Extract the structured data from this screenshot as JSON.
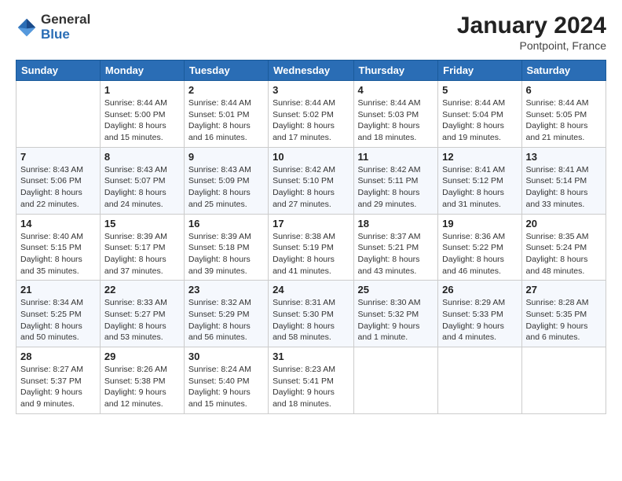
{
  "logo": {
    "general": "General",
    "blue": "Blue"
  },
  "title": "January 2024",
  "subtitle": "Pontpoint, France",
  "header_days": [
    "Sunday",
    "Monday",
    "Tuesday",
    "Wednesday",
    "Thursday",
    "Friday",
    "Saturday"
  ],
  "weeks": [
    [
      {
        "day": "",
        "info": ""
      },
      {
        "day": "1",
        "info": "Sunrise: 8:44 AM\nSunset: 5:00 PM\nDaylight: 8 hours\nand 15 minutes."
      },
      {
        "day": "2",
        "info": "Sunrise: 8:44 AM\nSunset: 5:01 PM\nDaylight: 8 hours\nand 16 minutes."
      },
      {
        "day": "3",
        "info": "Sunrise: 8:44 AM\nSunset: 5:02 PM\nDaylight: 8 hours\nand 17 minutes."
      },
      {
        "day": "4",
        "info": "Sunrise: 8:44 AM\nSunset: 5:03 PM\nDaylight: 8 hours\nand 18 minutes."
      },
      {
        "day": "5",
        "info": "Sunrise: 8:44 AM\nSunset: 5:04 PM\nDaylight: 8 hours\nand 19 minutes."
      },
      {
        "day": "6",
        "info": "Sunrise: 8:44 AM\nSunset: 5:05 PM\nDaylight: 8 hours\nand 21 minutes."
      }
    ],
    [
      {
        "day": "7",
        "info": "Sunrise: 8:43 AM\nSunset: 5:06 PM\nDaylight: 8 hours\nand 22 minutes."
      },
      {
        "day": "8",
        "info": "Sunrise: 8:43 AM\nSunset: 5:07 PM\nDaylight: 8 hours\nand 24 minutes."
      },
      {
        "day": "9",
        "info": "Sunrise: 8:43 AM\nSunset: 5:09 PM\nDaylight: 8 hours\nand 25 minutes."
      },
      {
        "day": "10",
        "info": "Sunrise: 8:42 AM\nSunset: 5:10 PM\nDaylight: 8 hours\nand 27 minutes."
      },
      {
        "day": "11",
        "info": "Sunrise: 8:42 AM\nSunset: 5:11 PM\nDaylight: 8 hours\nand 29 minutes."
      },
      {
        "day": "12",
        "info": "Sunrise: 8:41 AM\nSunset: 5:12 PM\nDaylight: 8 hours\nand 31 minutes."
      },
      {
        "day": "13",
        "info": "Sunrise: 8:41 AM\nSunset: 5:14 PM\nDaylight: 8 hours\nand 33 minutes."
      }
    ],
    [
      {
        "day": "14",
        "info": "Sunrise: 8:40 AM\nSunset: 5:15 PM\nDaylight: 8 hours\nand 35 minutes."
      },
      {
        "day": "15",
        "info": "Sunrise: 8:39 AM\nSunset: 5:17 PM\nDaylight: 8 hours\nand 37 minutes."
      },
      {
        "day": "16",
        "info": "Sunrise: 8:39 AM\nSunset: 5:18 PM\nDaylight: 8 hours\nand 39 minutes."
      },
      {
        "day": "17",
        "info": "Sunrise: 8:38 AM\nSunset: 5:19 PM\nDaylight: 8 hours\nand 41 minutes."
      },
      {
        "day": "18",
        "info": "Sunrise: 8:37 AM\nSunset: 5:21 PM\nDaylight: 8 hours\nand 43 minutes."
      },
      {
        "day": "19",
        "info": "Sunrise: 8:36 AM\nSunset: 5:22 PM\nDaylight: 8 hours\nand 46 minutes."
      },
      {
        "day": "20",
        "info": "Sunrise: 8:35 AM\nSunset: 5:24 PM\nDaylight: 8 hours\nand 48 minutes."
      }
    ],
    [
      {
        "day": "21",
        "info": "Sunrise: 8:34 AM\nSunset: 5:25 PM\nDaylight: 8 hours\nand 50 minutes."
      },
      {
        "day": "22",
        "info": "Sunrise: 8:33 AM\nSunset: 5:27 PM\nDaylight: 8 hours\nand 53 minutes."
      },
      {
        "day": "23",
        "info": "Sunrise: 8:32 AM\nSunset: 5:29 PM\nDaylight: 8 hours\nand 56 minutes."
      },
      {
        "day": "24",
        "info": "Sunrise: 8:31 AM\nSunset: 5:30 PM\nDaylight: 8 hours\nand 58 minutes."
      },
      {
        "day": "25",
        "info": "Sunrise: 8:30 AM\nSunset: 5:32 PM\nDaylight: 9 hours\nand 1 minute."
      },
      {
        "day": "26",
        "info": "Sunrise: 8:29 AM\nSunset: 5:33 PM\nDaylight: 9 hours\nand 4 minutes."
      },
      {
        "day": "27",
        "info": "Sunrise: 8:28 AM\nSunset: 5:35 PM\nDaylight: 9 hours\nand 6 minutes."
      }
    ],
    [
      {
        "day": "28",
        "info": "Sunrise: 8:27 AM\nSunset: 5:37 PM\nDaylight: 9 hours\nand 9 minutes."
      },
      {
        "day": "29",
        "info": "Sunrise: 8:26 AM\nSunset: 5:38 PM\nDaylight: 9 hours\nand 12 minutes."
      },
      {
        "day": "30",
        "info": "Sunrise: 8:24 AM\nSunset: 5:40 PM\nDaylight: 9 hours\nand 15 minutes."
      },
      {
        "day": "31",
        "info": "Sunrise: 8:23 AM\nSunset: 5:41 PM\nDaylight: 9 hours\nand 18 minutes."
      },
      {
        "day": "",
        "info": ""
      },
      {
        "day": "",
        "info": ""
      },
      {
        "day": "",
        "info": ""
      }
    ]
  ]
}
